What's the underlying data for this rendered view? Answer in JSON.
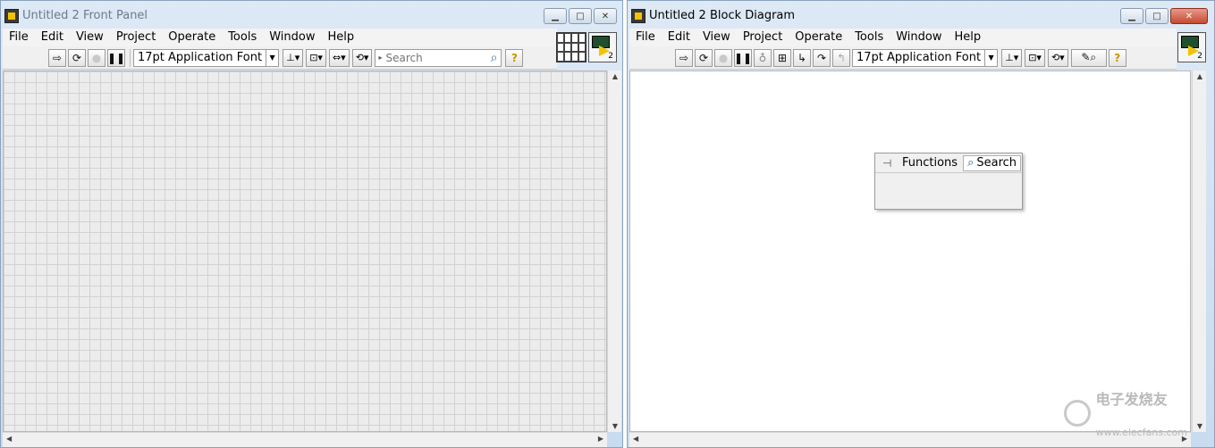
{
  "front_panel": {
    "title": "Untitled 2 Front Panel",
    "menu": [
      "File",
      "Edit",
      "View",
      "Project",
      "Operate",
      "Tools",
      "Window",
      "Help"
    ],
    "font": "17pt Application Font",
    "search_placeholder": "Search",
    "vi_icon_number": "2"
  },
  "block_diagram": {
    "title": "Untitled 2 Block Diagram",
    "menu": [
      "File",
      "Edit",
      "View",
      "Project",
      "Operate",
      "Tools",
      "Window",
      "Help"
    ],
    "font": "17pt Application Font",
    "vi_icon_number": "2",
    "palette": {
      "functions_label": "Functions",
      "search_label": "Search"
    }
  },
  "watermark": {
    "brand": "电子发烧友",
    "url": "www.elecfans.com"
  },
  "icons": {
    "run": "run-arrow-icon",
    "run_continuous": "run-continuously-icon",
    "abort": "abort-icon",
    "pause": "pause-icon",
    "highlight": "highlight-execution-icon",
    "search": "magnifier-icon",
    "help": "help-icon",
    "pin": "pin-icon"
  }
}
